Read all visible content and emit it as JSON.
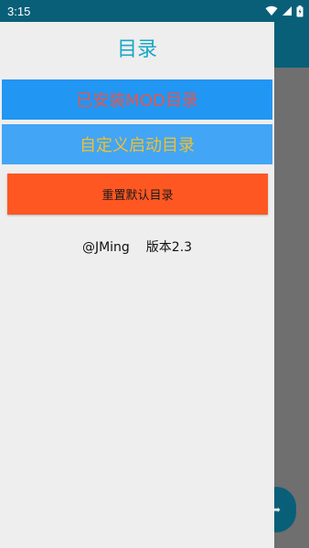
{
  "status_bar": {
    "time": "3:15",
    "icons": [
      "wifi-icon",
      "cellular-signal-icon",
      "battery-icon"
    ]
  },
  "drawer": {
    "title": "目录",
    "installed_mod_dir_label": "已安装MOD目录",
    "custom_launch_dir_label": "自定义启动目录",
    "reset_default_dir_label": "重置默认目录",
    "author": "@JMing",
    "version": "版本2.3"
  },
  "colors": {
    "status_bar_bg": "#0a5f78",
    "drawer_bg": "#eeeeee",
    "title_color": "#1aa7c7",
    "installed_btn_bg": "#2196f3",
    "installed_btn_text": "#e4574f",
    "custom_btn_bg": "#42a5f5",
    "custom_btn_text": "#f0c030",
    "reset_btn_bg": "#ff5722",
    "scrim": "#6f6f6f"
  },
  "background": {
    "fab_icon": "arrow-icon"
  }
}
